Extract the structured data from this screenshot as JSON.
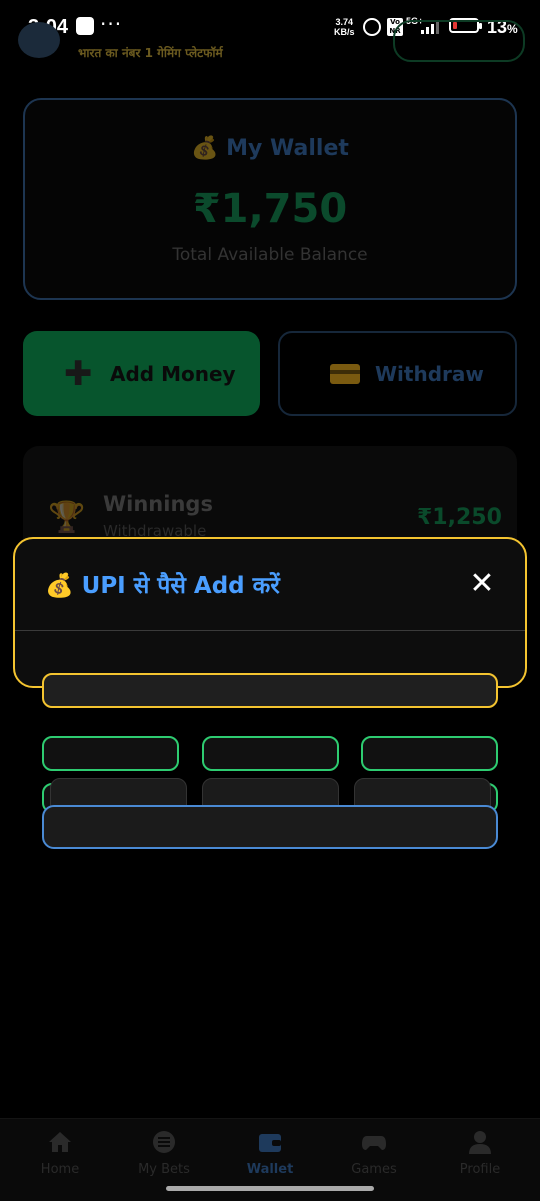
{
  "status_bar": {
    "time": "3:04",
    "speed_value": "3.74",
    "speed_unit": "KB/s",
    "network": "5G+",
    "battery": "13",
    "battery_suffix": "%"
  },
  "header": {
    "tagline": "भारत का नंबर 1 गेमिंग प्लेटफॉर्म"
  },
  "wallet": {
    "icon": "💰",
    "title": "My Wallet",
    "balance": "₹1,750",
    "subtitle": "Total Available Balance"
  },
  "actions": {
    "add_icon": "➕",
    "add_label": "Add Money",
    "withdraw_label": "Withdraw"
  },
  "winnings": {
    "icon": "🏆",
    "title": "Winnings",
    "subtitle": "Withdrawable",
    "amount": "₹1,250"
  },
  "modal": {
    "title": "💰 UPI से पैसे Add करें",
    "close": "✕"
  },
  "bottom_nav": [
    {
      "label": "Home",
      "icon": "home-icon"
    },
    {
      "label": "My Bets",
      "icon": "list-icon"
    },
    {
      "label": "Wallet",
      "icon": "wallet-icon"
    },
    {
      "label": "Games",
      "icon": "gamepad-icon"
    },
    {
      "label": "Profile",
      "icon": "user-icon"
    }
  ],
  "colors": {
    "modal_border": "#f4c430",
    "modal_title": "#4a9eff",
    "quick_border": "#2ecc71",
    "upi_border": "#4a8ad4"
  }
}
